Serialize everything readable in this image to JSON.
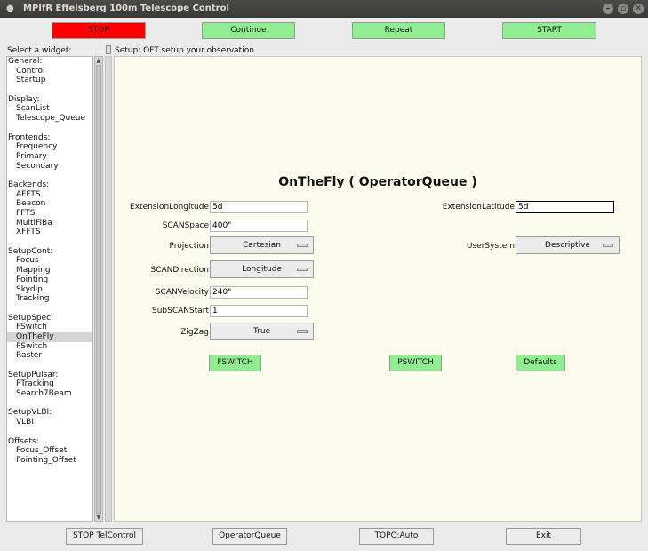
{
  "window": {
    "title": "MPIfR Effelsberg 100m Telescope Control",
    "menu_glyph": "●",
    "min_glyph": "–",
    "max_glyph": "▫",
    "close_glyph": "✕"
  },
  "top_buttons": {
    "stop": "STOP",
    "continue": "Continue",
    "repeat": "Repeat",
    "start": "START"
  },
  "sidebar": {
    "header": "Select a widget:",
    "groups": [
      {
        "title": "General:",
        "items": [
          "Control",
          "Startup"
        ]
      },
      {
        "title": "Display:",
        "items": [
          "ScanList",
          "Telescope_Queue"
        ]
      },
      {
        "title": "Frontends:",
        "items": [
          "Frequency",
          "Primary",
          "Secondary"
        ]
      },
      {
        "title": "Backends:",
        "items": [
          "AFFTS",
          "Beacon",
          "FFTS",
          "MultiFiBa",
          "XFFTS"
        ]
      },
      {
        "title": "SetupCont:",
        "items": [
          "Focus",
          "Mapping",
          "Pointing",
          "Skydip",
          "Tracking"
        ]
      },
      {
        "title": "SetupSpec:",
        "items": [
          "FSwitch",
          "OnTheFly",
          "PSwitch",
          "Raster"
        ]
      },
      {
        "title": "SetupPulsar:",
        "items": [
          "PTracking",
          "Search7Beam"
        ]
      },
      {
        "title": "SetupVLBI:",
        "items": [
          "VLBI"
        ]
      },
      {
        "title": "Offsets:",
        "items": [
          "Focus_Offset",
          "Pointing_Offset"
        ]
      }
    ],
    "selected": "OnTheFly"
  },
  "setup": {
    "header": "Setup: OFT   setup your observation"
  },
  "panel": {
    "title": "OnTheFly ( OperatorQueue )",
    "ext_lon_label": "ExtensionLongitude",
    "ext_lon_value": "5d",
    "ext_lat_label": "ExtensionLatitude",
    "ext_lat_value": "5d",
    "scanspace_label": "SCANSpace",
    "scanspace_value": "400\"",
    "projection_label": "Projection",
    "projection_value": "Cartesian",
    "usersystem_label": "UserSystem",
    "usersystem_value": "Descriptive",
    "scandir_label": "SCANDirection",
    "scandir_value": "Longitude",
    "scanvel_label": "SCANVelocity",
    "scanvel_value": "240\"",
    "subscan_label": "SubSCANStart",
    "subscan_value": "1",
    "zigzag_label": "ZigZag",
    "zigzag_value": "True",
    "fswitch": "FSWITCH",
    "pswitch": "PSWITCH",
    "defaults": "Defaults"
  },
  "bottom_buttons": {
    "stop_telcontrol": "STOP TelControl",
    "operator_queue": "OperatorQueue",
    "topo": "TOPO:Auto",
    "exit": "Exit"
  },
  "colors": {
    "stop": "#ff0000",
    "green": "#90ee90",
    "panel_bg": "#fcfcee"
  }
}
